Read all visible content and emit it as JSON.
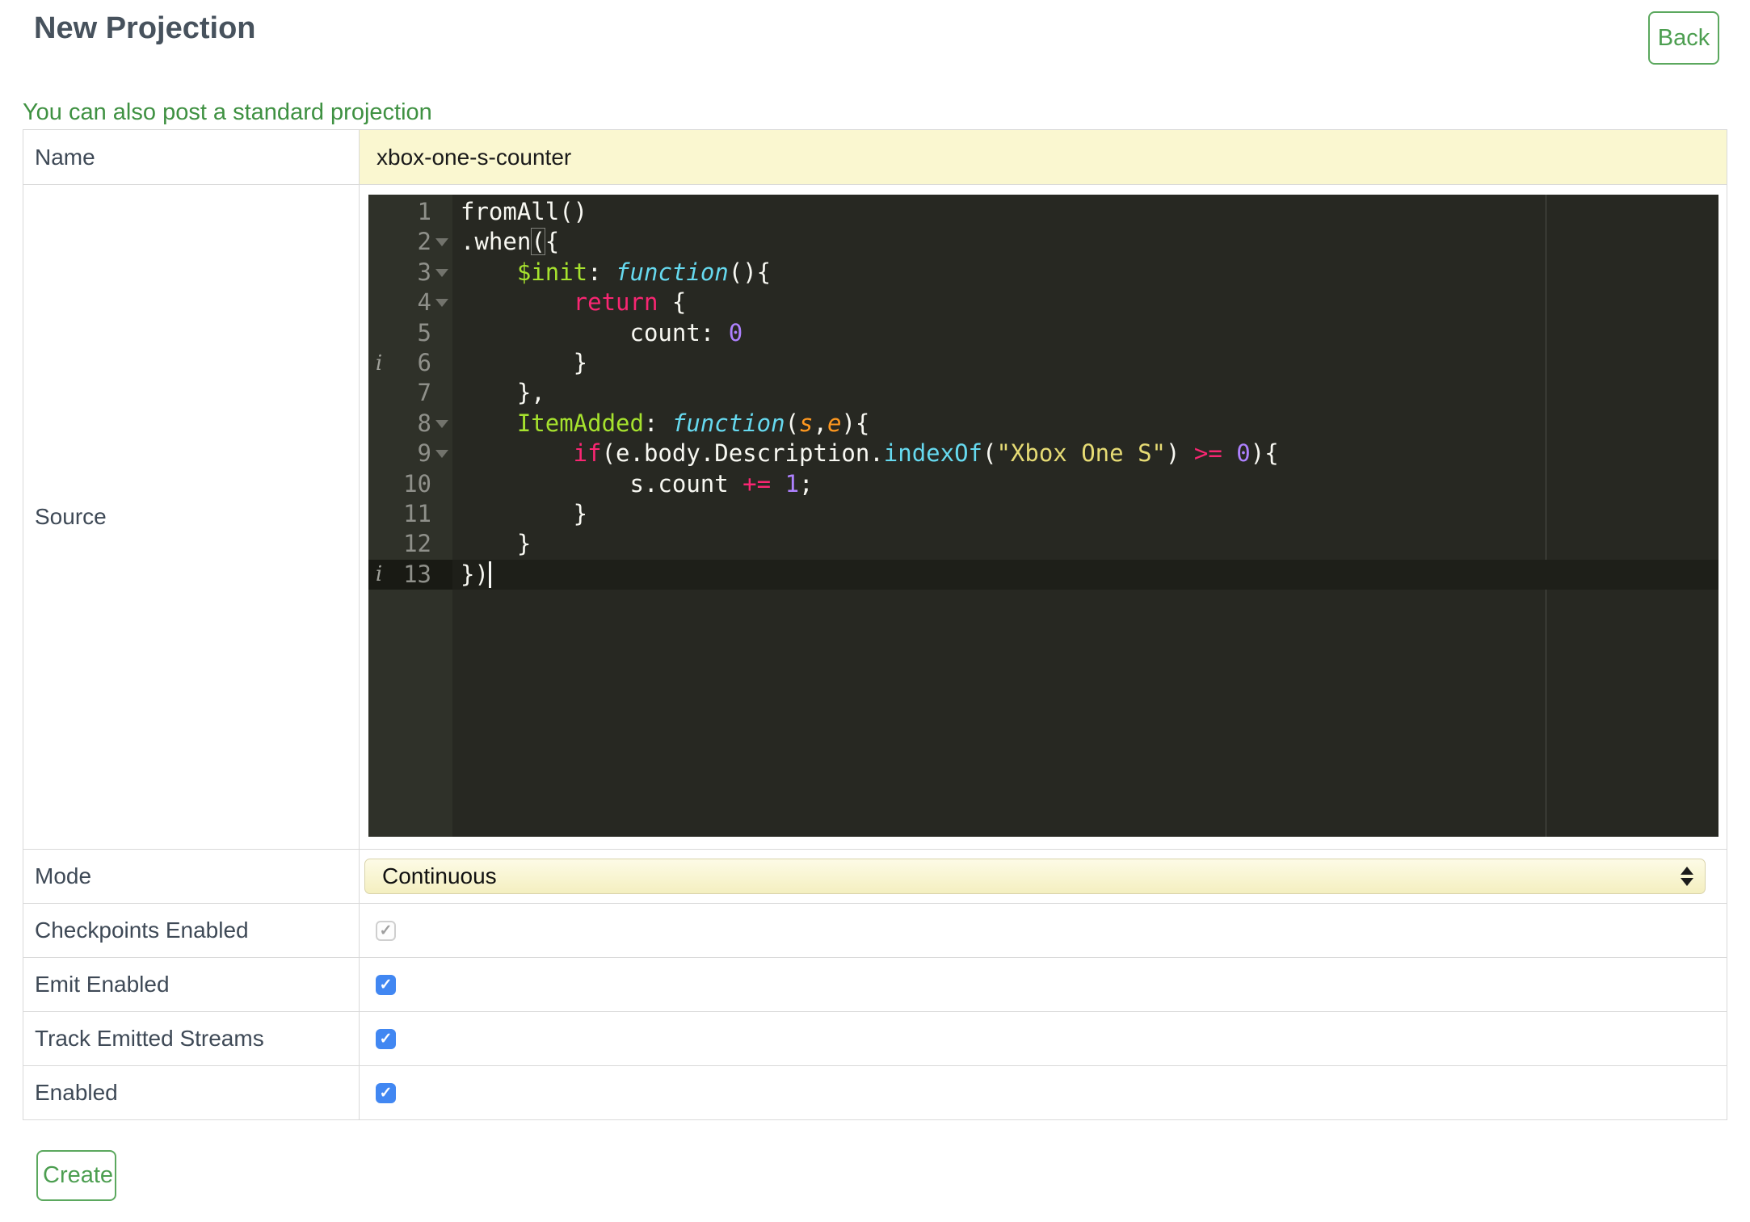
{
  "header": {
    "title": "New Projection",
    "back_label": "Back",
    "link_text": "You can also post a standard projection"
  },
  "form": {
    "name": {
      "label": "Name",
      "value": "xbox-one-s-counter"
    },
    "source": {
      "label": "Source"
    },
    "mode": {
      "label": "Mode",
      "value": "Continuous"
    },
    "checkboxes": [
      {
        "label": "Checkpoints Enabled",
        "checked": true,
        "disabled": true
      },
      {
        "label": "Emit Enabled",
        "checked": true,
        "disabled": false
      },
      {
        "label": "Track Emitted Streams",
        "checked": true,
        "disabled": false
      },
      {
        "label": "Enabled",
        "checked": true,
        "disabled": false
      }
    ]
  },
  "footer": {
    "create_label": "Create"
  },
  "colors": {
    "accent_green_text": "#4c9e50",
    "accent_green_border": "#5ba85e",
    "link_green": "#3f9142",
    "label_slate": "#3e4956",
    "input_yellow": "#faf7d0",
    "checkbox_blue": "#4187f2",
    "editor_background": "#272822",
    "editor_gutter": "#2f3129",
    "token_plain": "#f8f8f2",
    "token_green": "#a6e22e",
    "token_cyan": "#66d9ef",
    "token_pink": "#f92672",
    "token_purple": "#ae81ff",
    "token_string_yellow": "#e6db74",
    "token_orange": "#fd971f"
  },
  "editor": {
    "language": "javascript",
    "line_count": 13,
    "lines": [
      {
        "n": 1,
        "indent": 0,
        "tokens": [
          [
            "p",
            "fromAll()"
          ]
        ]
      },
      {
        "n": 2,
        "indent": 0,
        "fold": true,
        "tokens": [
          [
            "p",
            ".when"
          ],
          [
            "m",
            "("
          ],
          [
            "p",
            "{"
          ]
        ]
      },
      {
        "n": 3,
        "indent": 1,
        "fold": true,
        "tokens": [
          [
            "g",
            "$init"
          ],
          [
            "p",
            ": "
          ],
          [
            "f",
            "function"
          ],
          [
            "p",
            "(){"
          ]
        ]
      },
      {
        "n": 4,
        "indent": 2,
        "fold": true,
        "tokens": [
          [
            "k",
            "return"
          ],
          [
            "p",
            " {"
          ]
        ]
      },
      {
        "n": 5,
        "indent": 3,
        "tokens": [
          [
            "p",
            "count: "
          ],
          [
            "num",
            "0"
          ]
        ]
      },
      {
        "n": 6,
        "indent": 2,
        "info": true,
        "tokens": [
          [
            "p",
            "}"
          ]
        ]
      },
      {
        "n": 7,
        "indent": 1,
        "tokens": [
          [
            "p",
            "},"
          ]
        ]
      },
      {
        "n": 8,
        "indent": 1,
        "fold": true,
        "tokens": [
          [
            "g",
            "ItemAdded"
          ],
          [
            "p",
            ": "
          ],
          [
            "f",
            "function"
          ],
          [
            "p",
            "("
          ],
          [
            "o",
            "s"
          ],
          [
            "p",
            ","
          ],
          [
            "o",
            "e"
          ],
          [
            "p",
            "){"
          ]
        ]
      },
      {
        "n": 9,
        "indent": 2,
        "fold": true,
        "tokens": [
          [
            "k",
            "if"
          ],
          [
            "p",
            "(e.body.Description."
          ],
          [
            "b",
            "indexOf"
          ],
          [
            "p",
            "("
          ],
          [
            "s",
            "\"Xbox One S\""
          ],
          [
            "p",
            ") "
          ],
          [
            "k",
            ">="
          ],
          [
            "p",
            " "
          ],
          [
            "num",
            "0"
          ],
          [
            "p",
            "){"
          ]
        ]
      },
      {
        "n": 10,
        "indent": 3,
        "tokens": [
          [
            "p",
            "s.count "
          ],
          [
            "k",
            "+="
          ],
          [
            "p",
            " "
          ],
          [
            "num",
            "1"
          ],
          [
            "p",
            ";"
          ]
        ]
      },
      {
        "n": 11,
        "indent": 2,
        "tokens": [
          [
            "p",
            "}"
          ]
        ]
      },
      {
        "n": 12,
        "indent": 1,
        "tokens": [
          [
            "p",
            "}"
          ]
        ]
      },
      {
        "n": 13,
        "indent": 0,
        "info": true,
        "active": true,
        "cursor": true,
        "tokens": [
          [
            "p",
            "})"
          ]
        ]
      }
    ]
  }
}
